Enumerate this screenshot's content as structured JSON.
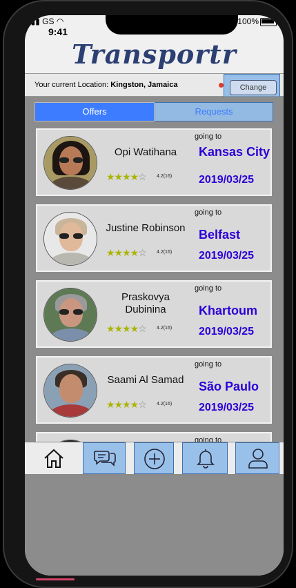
{
  "status_bar": {
    "carrier": "GS",
    "time": "9:41",
    "battery": "100%"
  },
  "app": {
    "logo": "Transportr"
  },
  "location_bar": {
    "prefix": "Your current Location:",
    "location": "Kingston, Jamaica",
    "change_label": "Change"
  },
  "tabs": [
    {
      "label": "Offers",
      "active": true
    },
    {
      "label": "Requests",
      "active": false
    }
  ],
  "offers": [
    {
      "name": "Opi Watihana",
      "rating_stars": 4,
      "rating": "4.2(16)",
      "going_label": "going to",
      "destination": "Kansas City",
      "date": "2019/03/25"
    },
    {
      "name": "Justine Robinson",
      "rating_stars": 4,
      "rating": "4.2(16)",
      "going_label": "going to",
      "destination": "Belfast",
      "date": "2019/03/25"
    },
    {
      "name": "Praskovya Dubinina",
      "rating_stars": 4,
      "rating": "4.2(16)",
      "going_label": "going to",
      "destination": "Khartoum",
      "date": "2019/03/25"
    },
    {
      "name": "Saami Al Samad",
      "rating_stars": 4,
      "rating": "4.2(16)",
      "going_label": "going to",
      "destination": "São Paulo",
      "date": "2019/03/25"
    },
    {
      "going_label": "going to"
    }
  ],
  "bottom_nav": [
    {
      "icon": "home-icon"
    },
    {
      "icon": "chat-icon"
    },
    {
      "icon": "add-icon"
    },
    {
      "icon": "bell-icon"
    },
    {
      "icon": "user-icon"
    }
  ],
  "colors": {
    "accent": "#3d7cff",
    "destination": "#2b00d8",
    "logo": "#2b3f73",
    "highlight": "#569ce8"
  }
}
